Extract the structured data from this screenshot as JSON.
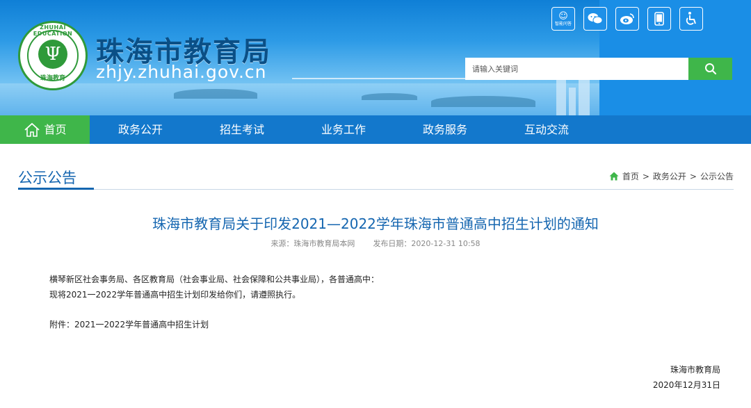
{
  "header": {
    "site_title": "珠海市教育局",
    "site_url": "zhjy.zhuhai.gov.cn",
    "logo": {
      "ring_text": "ZHUHAI EDUCATION",
      "bottom_text": "珠海教育",
      "emblem_glyph": "Ψ"
    },
    "top_icons": [
      {
        "name": "ai-assistant-icon",
        "glyph": "☺",
        "caption": "智能问答"
      },
      {
        "name": "wechat-icon",
        "glyph": "✉"
      },
      {
        "name": "weibo-icon",
        "glyph": "◉"
      },
      {
        "name": "mobile-icon",
        "glyph": "▯"
      },
      {
        "name": "accessibility-icon",
        "glyph": "♿"
      }
    ],
    "search": {
      "placeholder": "请输入关键词",
      "button_icon": "search-icon"
    }
  },
  "nav": {
    "items": [
      {
        "label": "首页",
        "active": true
      },
      {
        "label": "政务公开"
      },
      {
        "label": "招生考试"
      },
      {
        "label": "业务工作"
      },
      {
        "label": "政务服务"
      },
      {
        "label": "互动交流"
      }
    ]
  },
  "section": {
    "title": "公示公告",
    "breadcrumb": [
      "首页",
      ">",
      "政务公开",
      ">",
      "公示公告"
    ]
  },
  "article": {
    "title": "珠海市教育局关于印发2021—2022学年珠海市普通高中招生计划的通知",
    "source": "来源：珠海市教育局本网",
    "date": "发布日期：2020-12-31 10:58",
    "paragraphs": [
      "横琴新区社会事务局、各区教育局（社会事业局、社会保障和公共事业局），各普通高中：",
      "现将2021一2022学年普通高中招生计划印发给你们，请遵照执行。",
      "附件：2021一2022学年普通高中招生计划"
    ],
    "signature": "珠海市教育局",
    "sign_date": "2020年12月31日"
  },
  "colors": {
    "nav_bg": "#1378cc",
    "accent_green": "#3fb64a",
    "title_blue": "#1566b0"
  }
}
